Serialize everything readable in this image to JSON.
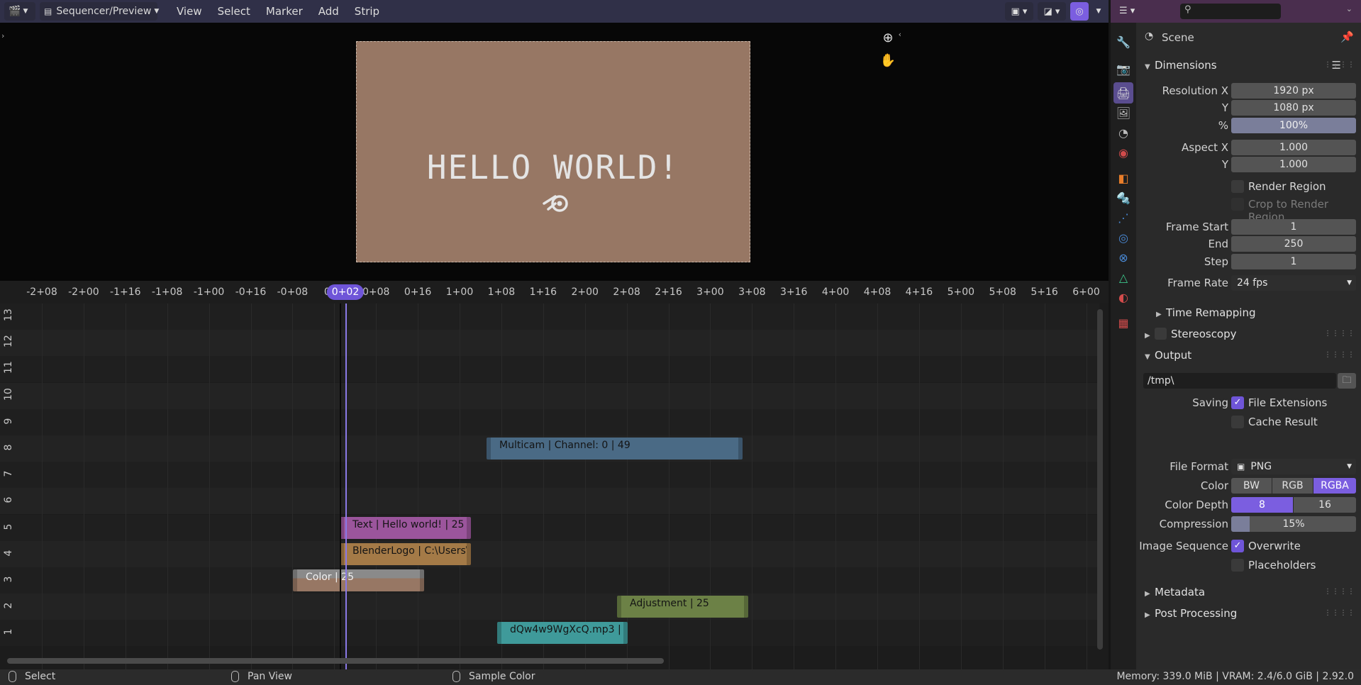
{
  "header": {
    "editor_label": "Sequencer/Preview",
    "menu": [
      "View",
      "Select",
      "Marker",
      "Add",
      "Strip"
    ]
  },
  "preview": {
    "canvas_text": "HELLO WORLD!",
    "canvas_color": "#977764"
  },
  "timeline": {
    "ticks": [
      "-2+08",
      "-2+00",
      "-1+16",
      "-1+08",
      "-1+00",
      "-0+16",
      "-0+08",
      "0",
      "0+08",
      "0+16",
      "1+00",
      "1+08",
      "1+16",
      "2+00",
      "2+08",
      "2+16",
      "3+00",
      "3+08",
      "3+16",
      "4+00",
      "4+08",
      "4+16",
      "5+00",
      "5+08",
      "5+16",
      "6+00"
    ],
    "current_frame": "0+02",
    "channels": [
      "13",
      "12",
      "11",
      "10",
      "9",
      "8",
      "7",
      "6",
      "5",
      "4",
      "3",
      "2",
      "1"
    ],
    "strips": [
      {
        "label": "Multicam | Channel: 0 | 49",
        "channel": 8,
        "color": "#4a6a85"
      },
      {
        "label": "Text | Hello world! | 25",
        "channel": 5,
        "color": "#9b559c"
      },
      {
        "label": "BlenderLogo | C:\\Users\\",
        "channel": 4,
        "color": "#a47a47"
      },
      {
        "label": "Color | 25",
        "channel": 3,
        "color": "#977764"
      },
      {
        "label": "Adjustment | 25",
        "channel": 2,
        "color": "#6c8146"
      },
      {
        "label": "dQw4w9WgXcQ.mp3 |",
        "channel": 1,
        "color": "#3f9a9a"
      }
    ]
  },
  "status": {
    "select": "Select",
    "pan_view": "Pan View",
    "sample_color": "Sample Color",
    "memory": "Memory: 339.0 MiB | VRAM: 2.4/6.0 GiB | 2.92.0"
  },
  "properties": {
    "scene_label": "Scene",
    "dimensions": {
      "title": "Dimensions",
      "resolution_x_label": "Resolution X",
      "resolution_x": "1920 px",
      "resolution_y_label": "Y",
      "resolution_y": "1080 px",
      "percent_label": "%",
      "percent": "100%",
      "aspect_x_label": "Aspect X",
      "aspect_x": "1.000",
      "aspect_y_label": "Y",
      "aspect_y": "1.000",
      "render_region": "Render Region",
      "crop_region": "Crop to Render Region",
      "frame_start_label": "Frame Start",
      "frame_start": "1",
      "end_label": "End",
      "end": "250",
      "step_label": "Step",
      "step": "1",
      "frame_rate_label": "Frame Rate",
      "frame_rate": "24 fps",
      "time_remapping": "Time Remapping"
    },
    "stereoscopy": "Stereoscopy",
    "output": {
      "title": "Output",
      "path": "/tmp\\",
      "saving_label": "Saving",
      "file_extensions": "File Extensions",
      "cache_result": "Cache Result",
      "file_format_label": "File Format",
      "file_format": "PNG",
      "color_label": "Color",
      "color_options": [
        "BW",
        "RGB",
        "RGBA"
      ],
      "color_depth_label": "Color Depth",
      "color_depth_options": [
        "8",
        "16"
      ],
      "compression_label": "Compression",
      "compression": "15%",
      "compression_level": 0.15,
      "image_sequence_label": "Image Sequence",
      "overwrite": "Overwrite",
      "placeholders": "Placeholders"
    },
    "metadata": "Metadata",
    "post_processing": "Post Processing"
  }
}
